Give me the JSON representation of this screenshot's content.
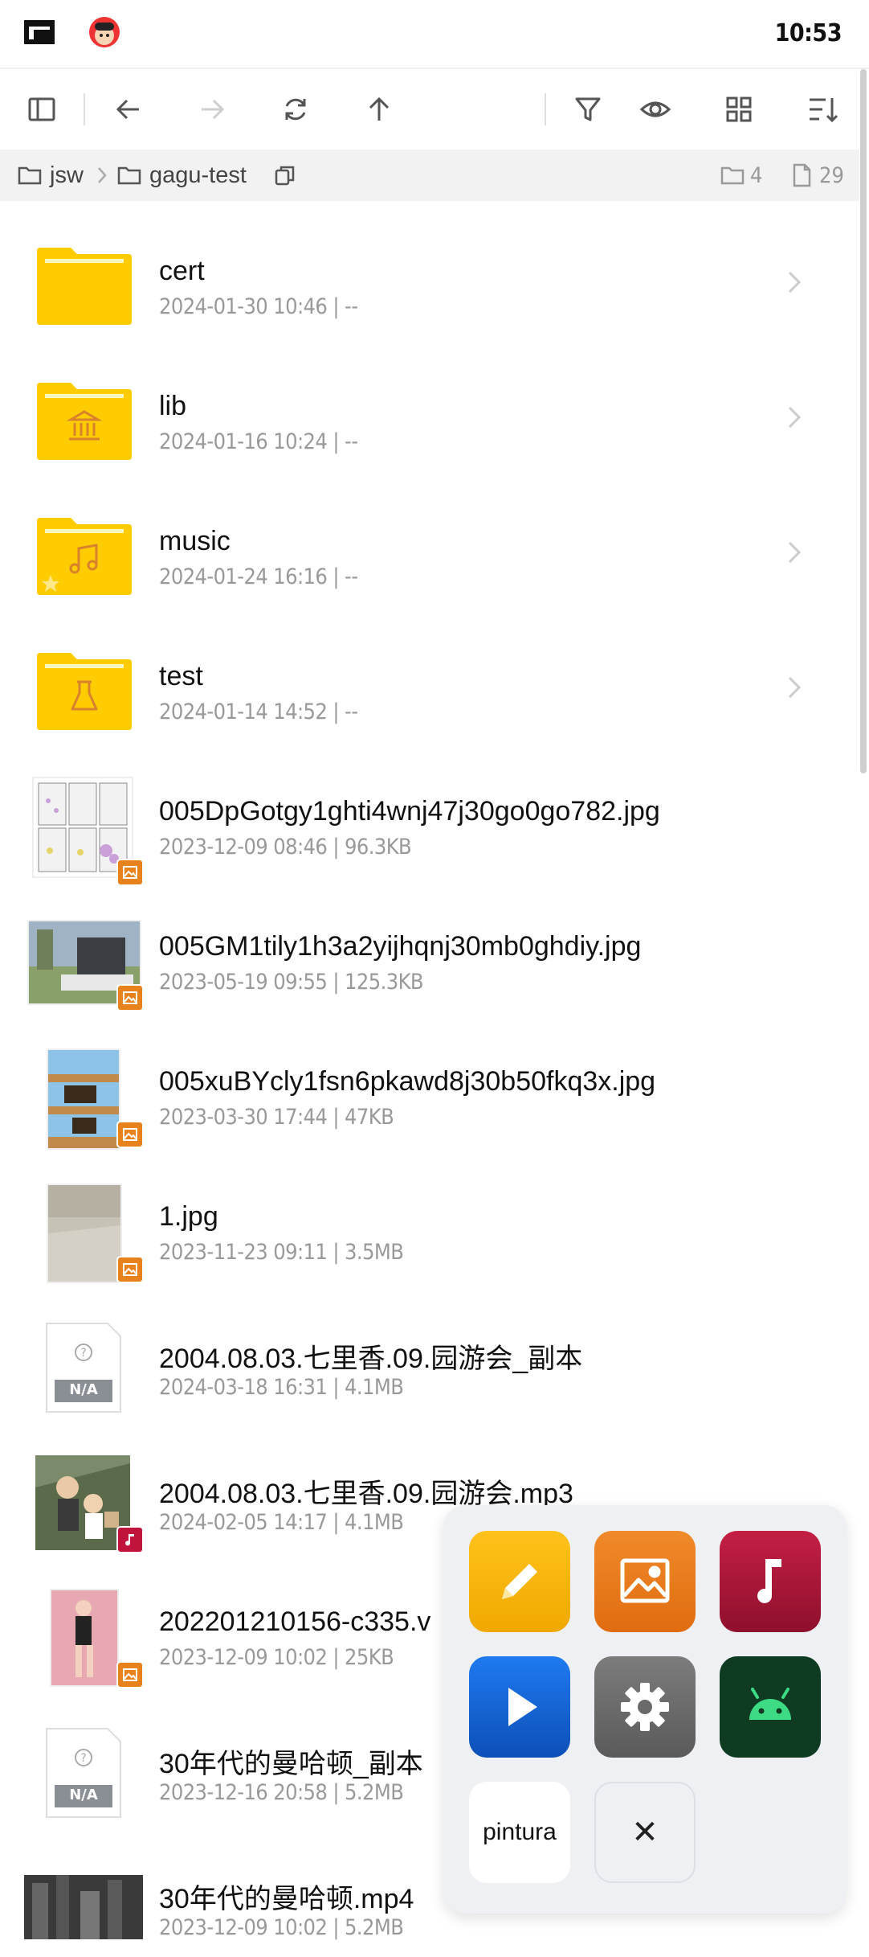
{
  "status": {
    "time": "10:53",
    "icons": [
      "app-logo-icon",
      "avatar-icon"
    ]
  },
  "toolbar": {
    "icons": [
      "sidebar-toggle-icon",
      "back-arrow-icon",
      "forward-arrow-icon",
      "refresh-icon",
      "up-arrow-icon",
      "filter-icon",
      "eye-icon",
      "grid-view-icon",
      "sort-icon"
    ]
  },
  "breadcrumb": {
    "root": "jsw",
    "current": "gagu-test",
    "folder_count": "4",
    "file_count": "29"
  },
  "items": [
    {
      "name": "cert",
      "meta": "2024-01-30 10:46 | --",
      "kind": "folder",
      "icon": "folder-icon"
    },
    {
      "name": "lib",
      "meta": "2024-01-16 10:24 | --",
      "kind": "folder",
      "icon": "library-folder-icon"
    },
    {
      "name": "music",
      "meta": "2024-01-24 16:16 | --",
      "kind": "folder",
      "icon": "music-folder-icon"
    },
    {
      "name": "test",
      "meta": "2024-01-14 14:52 | --",
      "kind": "folder",
      "icon": "flask-folder-icon"
    },
    {
      "name": "005DpGotgy1ghti4wnj47j30go0go782.jpg",
      "meta": "2023-12-09 08:46 | 96.3KB",
      "kind": "image"
    },
    {
      "name": "005GM1tily1h3a2yijhqnj30mb0ghdiy.jpg",
      "meta": "2023-05-19 09:55 | 125.3KB",
      "kind": "image"
    },
    {
      "name": "005xuBYcly1fsn6pkawd8j30b50fkq3x.jpg",
      "meta": "2023-03-30 17:44 | 47KB",
      "kind": "image"
    },
    {
      "name": "1.jpg",
      "meta": "2023-11-23 09:11 | 3.5MB",
      "kind": "image"
    },
    {
      "name": "2004.08.03.七里香.09.园游会_副本",
      "meta": "2024-03-18 16:31 | 4.1MB",
      "kind": "unknown",
      "badge": "N/A"
    },
    {
      "name": "2004.08.03.七里香.09.园游会.mp3",
      "meta": "2024-02-05 14:17 | 4.1MB",
      "kind": "audio"
    },
    {
      "name": "202201210156-c335.v",
      "meta": "2023-12-09 10:02 | 25KB",
      "kind": "image"
    },
    {
      "name": "30年代的曼哈顿_副本",
      "meta": "2023-12-16 20:58 | 5.2MB",
      "kind": "unknown",
      "badge": "N/A"
    },
    {
      "name": "30年代的曼哈顿.mp4",
      "meta": "2023-12-09 10:02 | 5.2MB",
      "kind": "video"
    }
  ],
  "launcher": {
    "apps": [
      {
        "name": "editor-app",
        "icon": "pencil-icon",
        "color": "#f5b800"
      },
      {
        "name": "image-viewer-app",
        "icon": "image-icon",
        "color": "#e8761a"
      },
      {
        "name": "music-player-app",
        "icon": "music-note-icon",
        "color": "#b0143a"
      },
      {
        "name": "video-player-app",
        "icon": "play-icon",
        "color": "#1565d8"
      },
      {
        "name": "settings-app",
        "icon": "gear-icon",
        "color": "#6e6e6e"
      },
      {
        "name": "android-app",
        "icon": "android-icon",
        "color": "#0b3a22"
      }
    ],
    "pintura_label": "pintura",
    "close_label": "✕"
  }
}
